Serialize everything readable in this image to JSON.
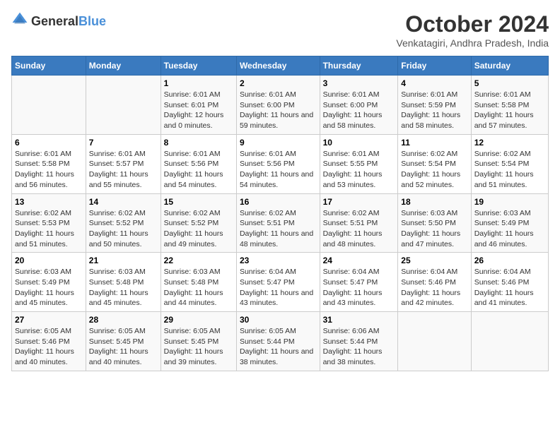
{
  "logo": {
    "general": "General",
    "blue": "Blue"
  },
  "title": "October 2024",
  "subtitle": "Venkatagiri, Andhra Pradesh, India",
  "headers": [
    "Sunday",
    "Monday",
    "Tuesday",
    "Wednesday",
    "Thursday",
    "Friday",
    "Saturday"
  ],
  "weeks": [
    [
      {
        "day": "",
        "sunrise": "",
        "sunset": "",
        "daylight": ""
      },
      {
        "day": "",
        "sunrise": "",
        "sunset": "",
        "daylight": ""
      },
      {
        "day": "1",
        "sunrise": "Sunrise: 6:01 AM",
        "sunset": "Sunset: 6:01 PM",
        "daylight": "Daylight: 12 hours and 0 minutes."
      },
      {
        "day": "2",
        "sunrise": "Sunrise: 6:01 AM",
        "sunset": "Sunset: 6:00 PM",
        "daylight": "Daylight: 11 hours and 59 minutes."
      },
      {
        "day": "3",
        "sunrise": "Sunrise: 6:01 AM",
        "sunset": "Sunset: 6:00 PM",
        "daylight": "Daylight: 11 hours and 58 minutes."
      },
      {
        "day": "4",
        "sunrise": "Sunrise: 6:01 AM",
        "sunset": "Sunset: 5:59 PM",
        "daylight": "Daylight: 11 hours and 58 minutes."
      },
      {
        "day": "5",
        "sunrise": "Sunrise: 6:01 AM",
        "sunset": "Sunset: 5:58 PM",
        "daylight": "Daylight: 11 hours and 57 minutes."
      }
    ],
    [
      {
        "day": "6",
        "sunrise": "Sunrise: 6:01 AM",
        "sunset": "Sunset: 5:58 PM",
        "daylight": "Daylight: 11 hours and 56 minutes."
      },
      {
        "day": "7",
        "sunrise": "Sunrise: 6:01 AM",
        "sunset": "Sunset: 5:57 PM",
        "daylight": "Daylight: 11 hours and 55 minutes."
      },
      {
        "day": "8",
        "sunrise": "Sunrise: 6:01 AM",
        "sunset": "Sunset: 5:56 PM",
        "daylight": "Daylight: 11 hours and 54 minutes."
      },
      {
        "day": "9",
        "sunrise": "Sunrise: 6:01 AM",
        "sunset": "Sunset: 5:56 PM",
        "daylight": "Daylight: 11 hours and 54 minutes."
      },
      {
        "day": "10",
        "sunrise": "Sunrise: 6:01 AM",
        "sunset": "Sunset: 5:55 PM",
        "daylight": "Daylight: 11 hours and 53 minutes."
      },
      {
        "day": "11",
        "sunrise": "Sunrise: 6:02 AM",
        "sunset": "Sunset: 5:54 PM",
        "daylight": "Daylight: 11 hours and 52 minutes."
      },
      {
        "day": "12",
        "sunrise": "Sunrise: 6:02 AM",
        "sunset": "Sunset: 5:54 PM",
        "daylight": "Daylight: 11 hours and 51 minutes."
      }
    ],
    [
      {
        "day": "13",
        "sunrise": "Sunrise: 6:02 AM",
        "sunset": "Sunset: 5:53 PM",
        "daylight": "Daylight: 11 hours and 51 minutes."
      },
      {
        "day": "14",
        "sunrise": "Sunrise: 6:02 AM",
        "sunset": "Sunset: 5:52 PM",
        "daylight": "Daylight: 11 hours and 50 minutes."
      },
      {
        "day": "15",
        "sunrise": "Sunrise: 6:02 AM",
        "sunset": "Sunset: 5:52 PM",
        "daylight": "Daylight: 11 hours and 49 minutes."
      },
      {
        "day": "16",
        "sunrise": "Sunrise: 6:02 AM",
        "sunset": "Sunset: 5:51 PM",
        "daylight": "Daylight: 11 hours and 48 minutes."
      },
      {
        "day": "17",
        "sunrise": "Sunrise: 6:02 AM",
        "sunset": "Sunset: 5:51 PM",
        "daylight": "Daylight: 11 hours and 48 minutes."
      },
      {
        "day": "18",
        "sunrise": "Sunrise: 6:03 AM",
        "sunset": "Sunset: 5:50 PM",
        "daylight": "Daylight: 11 hours and 47 minutes."
      },
      {
        "day": "19",
        "sunrise": "Sunrise: 6:03 AM",
        "sunset": "Sunset: 5:49 PM",
        "daylight": "Daylight: 11 hours and 46 minutes."
      }
    ],
    [
      {
        "day": "20",
        "sunrise": "Sunrise: 6:03 AM",
        "sunset": "Sunset: 5:49 PM",
        "daylight": "Daylight: 11 hours and 45 minutes."
      },
      {
        "day": "21",
        "sunrise": "Sunrise: 6:03 AM",
        "sunset": "Sunset: 5:48 PM",
        "daylight": "Daylight: 11 hours and 45 minutes."
      },
      {
        "day": "22",
        "sunrise": "Sunrise: 6:03 AM",
        "sunset": "Sunset: 5:48 PM",
        "daylight": "Daylight: 11 hours and 44 minutes."
      },
      {
        "day": "23",
        "sunrise": "Sunrise: 6:04 AM",
        "sunset": "Sunset: 5:47 PM",
        "daylight": "Daylight: 11 hours and 43 minutes."
      },
      {
        "day": "24",
        "sunrise": "Sunrise: 6:04 AM",
        "sunset": "Sunset: 5:47 PM",
        "daylight": "Daylight: 11 hours and 43 minutes."
      },
      {
        "day": "25",
        "sunrise": "Sunrise: 6:04 AM",
        "sunset": "Sunset: 5:46 PM",
        "daylight": "Daylight: 11 hours and 42 minutes."
      },
      {
        "day": "26",
        "sunrise": "Sunrise: 6:04 AM",
        "sunset": "Sunset: 5:46 PM",
        "daylight": "Daylight: 11 hours and 41 minutes."
      }
    ],
    [
      {
        "day": "27",
        "sunrise": "Sunrise: 6:05 AM",
        "sunset": "Sunset: 5:46 PM",
        "daylight": "Daylight: 11 hours and 40 minutes."
      },
      {
        "day": "28",
        "sunrise": "Sunrise: 6:05 AM",
        "sunset": "Sunset: 5:45 PM",
        "daylight": "Daylight: 11 hours and 40 minutes."
      },
      {
        "day": "29",
        "sunrise": "Sunrise: 6:05 AM",
        "sunset": "Sunset: 5:45 PM",
        "daylight": "Daylight: 11 hours and 39 minutes."
      },
      {
        "day": "30",
        "sunrise": "Sunrise: 6:05 AM",
        "sunset": "Sunset: 5:44 PM",
        "daylight": "Daylight: 11 hours and 38 minutes."
      },
      {
        "day": "31",
        "sunrise": "Sunrise: 6:06 AM",
        "sunset": "Sunset: 5:44 PM",
        "daylight": "Daylight: 11 hours and 38 minutes."
      },
      {
        "day": "",
        "sunrise": "",
        "sunset": "",
        "daylight": ""
      },
      {
        "day": "",
        "sunrise": "",
        "sunset": "",
        "daylight": ""
      }
    ]
  ]
}
